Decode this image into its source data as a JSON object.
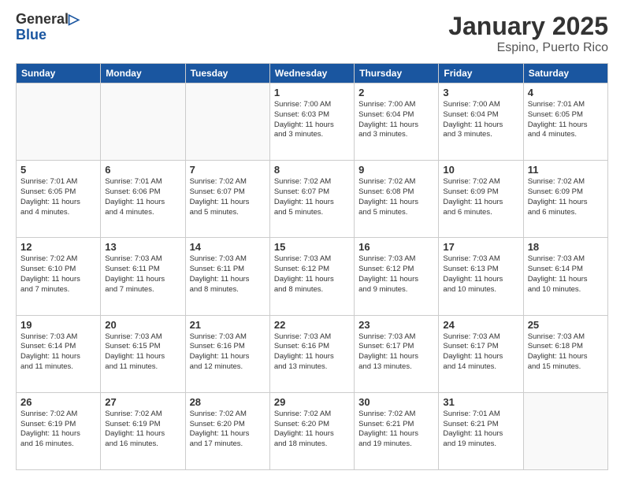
{
  "logo": {
    "general": "General",
    "blue": "Blue"
  },
  "header": {
    "title": "January 2025",
    "subtitle": "Espino, Puerto Rico"
  },
  "weekdays": [
    "Sunday",
    "Monday",
    "Tuesday",
    "Wednesday",
    "Thursday",
    "Friday",
    "Saturday"
  ],
  "weeks": [
    [
      {
        "day": "",
        "info": ""
      },
      {
        "day": "",
        "info": ""
      },
      {
        "day": "",
        "info": ""
      },
      {
        "day": "1",
        "info": "Sunrise: 7:00 AM\nSunset: 6:03 PM\nDaylight: 11 hours\nand 3 minutes."
      },
      {
        "day": "2",
        "info": "Sunrise: 7:00 AM\nSunset: 6:04 PM\nDaylight: 11 hours\nand 3 minutes."
      },
      {
        "day": "3",
        "info": "Sunrise: 7:00 AM\nSunset: 6:04 PM\nDaylight: 11 hours\nand 3 minutes."
      },
      {
        "day": "4",
        "info": "Sunrise: 7:01 AM\nSunset: 6:05 PM\nDaylight: 11 hours\nand 4 minutes."
      }
    ],
    [
      {
        "day": "5",
        "info": "Sunrise: 7:01 AM\nSunset: 6:05 PM\nDaylight: 11 hours\nand 4 minutes."
      },
      {
        "day": "6",
        "info": "Sunrise: 7:01 AM\nSunset: 6:06 PM\nDaylight: 11 hours\nand 4 minutes."
      },
      {
        "day": "7",
        "info": "Sunrise: 7:02 AM\nSunset: 6:07 PM\nDaylight: 11 hours\nand 5 minutes."
      },
      {
        "day": "8",
        "info": "Sunrise: 7:02 AM\nSunset: 6:07 PM\nDaylight: 11 hours\nand 5 minutes."
      },
      {
        "day": "9",
        "info": "Sunrise: 7:02 AM\nSunset: 6:08 PM\nDaylight: 11 hours\nand 5 minutes."
      },
      {
        "day": "10",
        "info": "Sunrise: 7:02 AM\nSunset: 6:09 PM\nDaylight: 11 hours\nand 6 minutes."
      },
      {
        "day": "11",
        "info": "Sunrise: 7:02 AM\nSunset: 6:09 PM\nDaylight: 11 hours\nand 6 minutes."
      }
    ],
    [
      {
        "day": "12",
        "info": "Sunrise: 7:02 AM\nSunset: 6:10 PM\nDaylight: 11 hours\nand 7 minutes."
      },
      {
        "day": "13",
        "info": "Sunrise: 7:03 AM\nSunset: 6:11 PM\nDaylight: 11 hours\nand 7 minutes."
      },
      {
        "day": "14",
        "info": "Sunrise: 7:03 AM\nSunset: 6:11 PM\nDaylight: 11 hours\nand 8 minutes."
      },
      {
        "day": "15",
        "info": "Sunrise: 7:03 AM\nSunset: 6:12 PM\nDaylight: 11 hours\nand 8 minutes."
      },
      {
        "day": "16",
        "info": "Sunrise: 7:03 AM\nSunset: 6:12 PM\nDaylight: 11 hours\nand 9 minutes."
      },
      {
        "day": "17",
        "info": "Sunrise: 7:03 AM\nSunset: 6:13 PM\nDaylight: 11 hours\nand 10 minutes."
      },
      {
        "day": "18",
        "info": "Sunrise: 7:03 AM\nSunset: 6:14 PM\nDaylight: 11 hours\nand 10 minutes."
      }
    ],
    [
      {
        "day": "19",
        "info": "Sunrise: 7:03 AM\nSunset: 6:14 PM\nDaylight: 11 hours\nand 11 minutes."
      },
      {
        "day": "20",
        "info": "Sunrise: 7:03 AM\nSunset: 6:15 PM\nDaylight: 11 hours\nand 11 minutes."
      },
      {
        "day": "21",
        "info": "Sunrise: 7:03 AM\nSunset: 6:16 PM\nDaylight: 11 hours\nand 12 minutes."
      },
      {
        "day": "22",
        "info": "Sunrise: 7:03 AM\nSunset: 6:16 PM\nDaylight: 11 hours\nand 13 minutes."
      },
      {
        "day": "23",
        "info": "Sunrise: 7:03 AM\nSunset: 6:17 PM\nDaylight: 11 hours\nand 13 minutes."
      },
      {
        "day": "24",
        "info": "Sunrise: 7:03 AM\nSunset: 6:17 PM\nDaylight: 11 hours\nand 14 minutes."
      },
      {
        "day": "25",
        "info": "Sunrise: 7:03 AM\nSunset: 6:18 PM\nDaylight: 11 hours\nand 15 minutes."
      }
    ],
    [
      {
        "day": "26",
        "info": "Sunrise: 7:02 AM\nSunset: 6:19 PM\nDaylight: 11 hours\nand 16 minutes."
      },
      {
        "day": "27",
        "info": "Sunrise: 7:02 AM\nSunset: 6:19 PM\nDaylight: 11 hours\nand 16 minutes."
      },
      {
        "day": "28",
        "info": "Sunrise: 7:02 AM\nSunset: 6:20 PM\nDaylight: 11 hours\nand 17 minutes."
      },
      {
        "day": "29",
        "info": "Sunrise: 7:02 AM\nSunset: 6:20 PM\nDaylight: 11 hours\nand 18 minutes."
      },
      {
        "day": "30",
        "info": "Sunrise: 7:02 AM\nSunset: 6:21 PM\nDaylight: 11 hours\nand 19 minutes."
      },
      {
        "day": "31",
        "info": "Sunrise: 7:01 AM\nSunset: 6:21 PM\nDaylight: 11 hours\nand 19 minutes."
      },
      {
        "day": "",
        "info": ""
      }
    ]
  ]
}
